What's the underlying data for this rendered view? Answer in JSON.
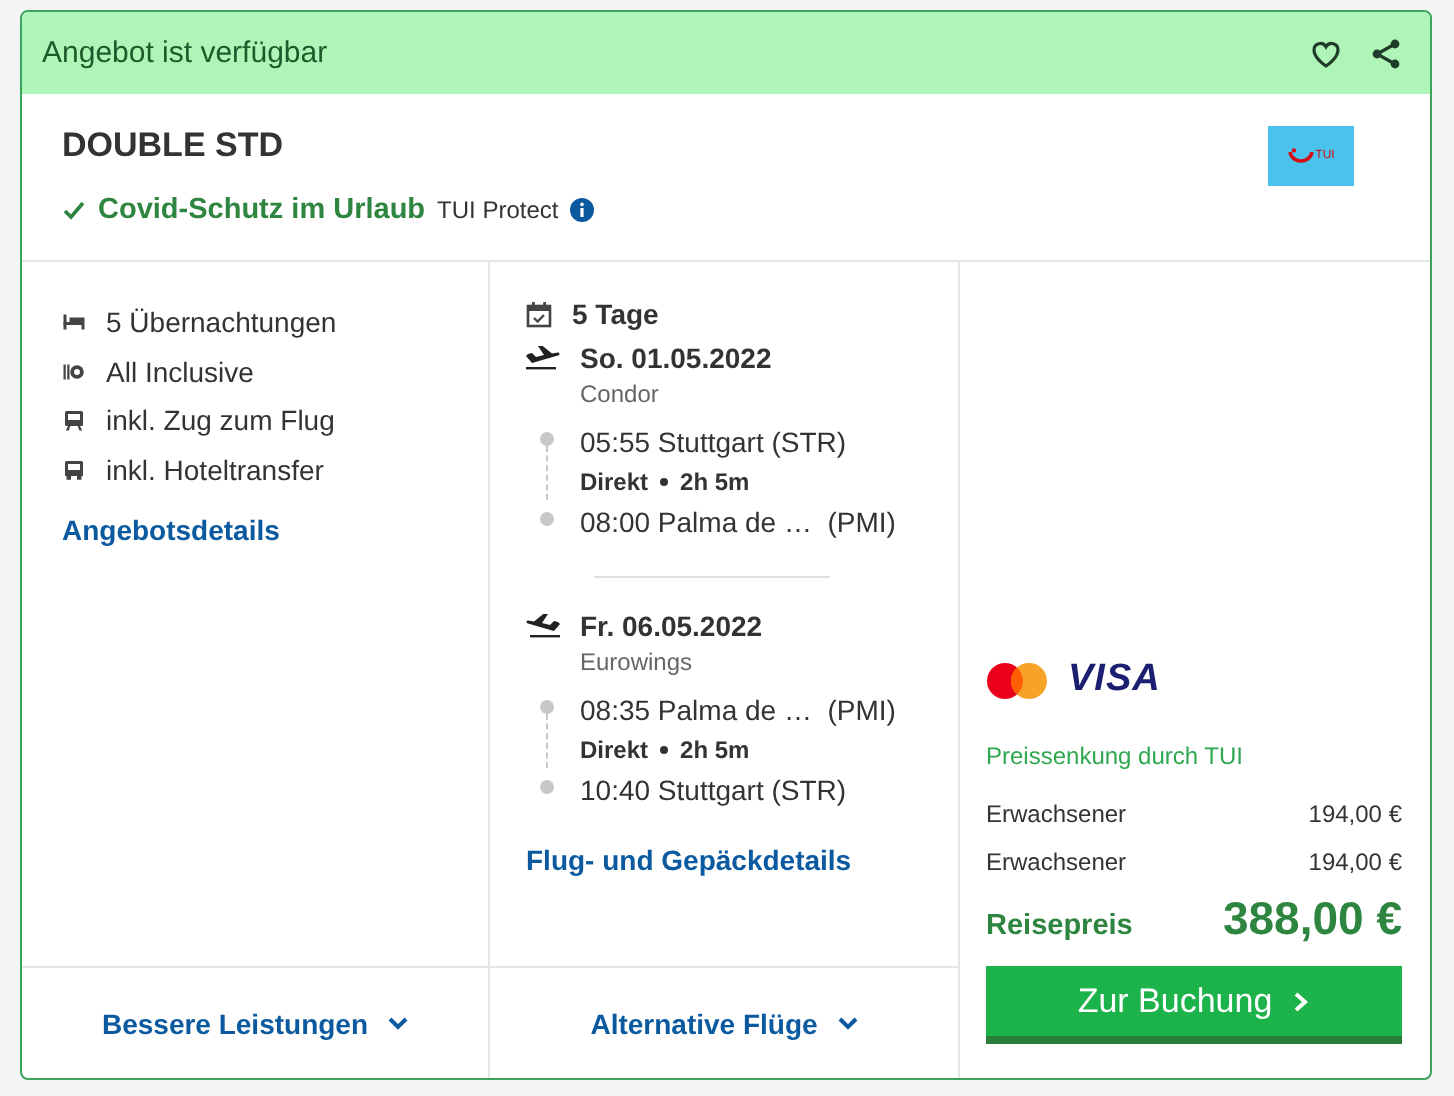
{
  "status": {
    "text": "Angebot ist verfügbar",
    "favorite": false
  },
  "offer": {
    "room": "DOUBLE STD",
    "protection": "Covid-Schutz im Urlaub",
    "protection_brand": "TUI Protect",
    "logo_text": "TUI"
  },
  "amenities": [
    {
      "kind": "bed",
      "text": "5 Übernachtungen"
    },
    {
      "kind": "meal",
      "text": "All Inclusive"
    },
    {
      "kind": "train",
      "text": "inkl. Zug zum Flug"
    },
    {
      "kind": "bus",
      "text": "inkl. Hoteltransfer"
    }
  ],
  "offer_details_link": "Angebotsdetails",
  "duration": "5 Tage",
  "flights": [
    {
      "kind": "outbound",
      "date": "So. 01.05.2022",
      "airline": "Condor",
      "departure": "05:55 Stuttgart (STR)",
      "stops": "Direkt",
      "flight_time": "2h 5m",
      "arrival": "08:00 Palma de …  (PMI)"
    },
    {
      "kind": "return",
      "date": "Fr. 06.05.2022",
      "airline": "Eurowings",
      "departure": "08:35 Palma de …  (PMI)",
      "stops": "Direkt",
      "flight_time": "2h 5m",
      "arrival": "10:40 Stuttgart (STR)"
    }
  ],
  "flight_details_link": "Flug- und Gepäckdetails",
  "payment": {
    "card_brand": "VISA"
  },
  "price": {
    "note": "Preissenkung durch TUI",
    "lines": [
      {
        "label": "Erwachsener",
        "amount": "194,00 €"
      },
      {
        "label": "Erwachsener",
        "amount": "194,00 €"
      }
    ],
    "total_label": "Reisepreis",
    "total": "388,00 €",
    "book_button": "Zur Buchung"
  },
  "footer_buttons": [
    "Bessere Leistungen",
    "Alternative Flüge"
  ]
}
